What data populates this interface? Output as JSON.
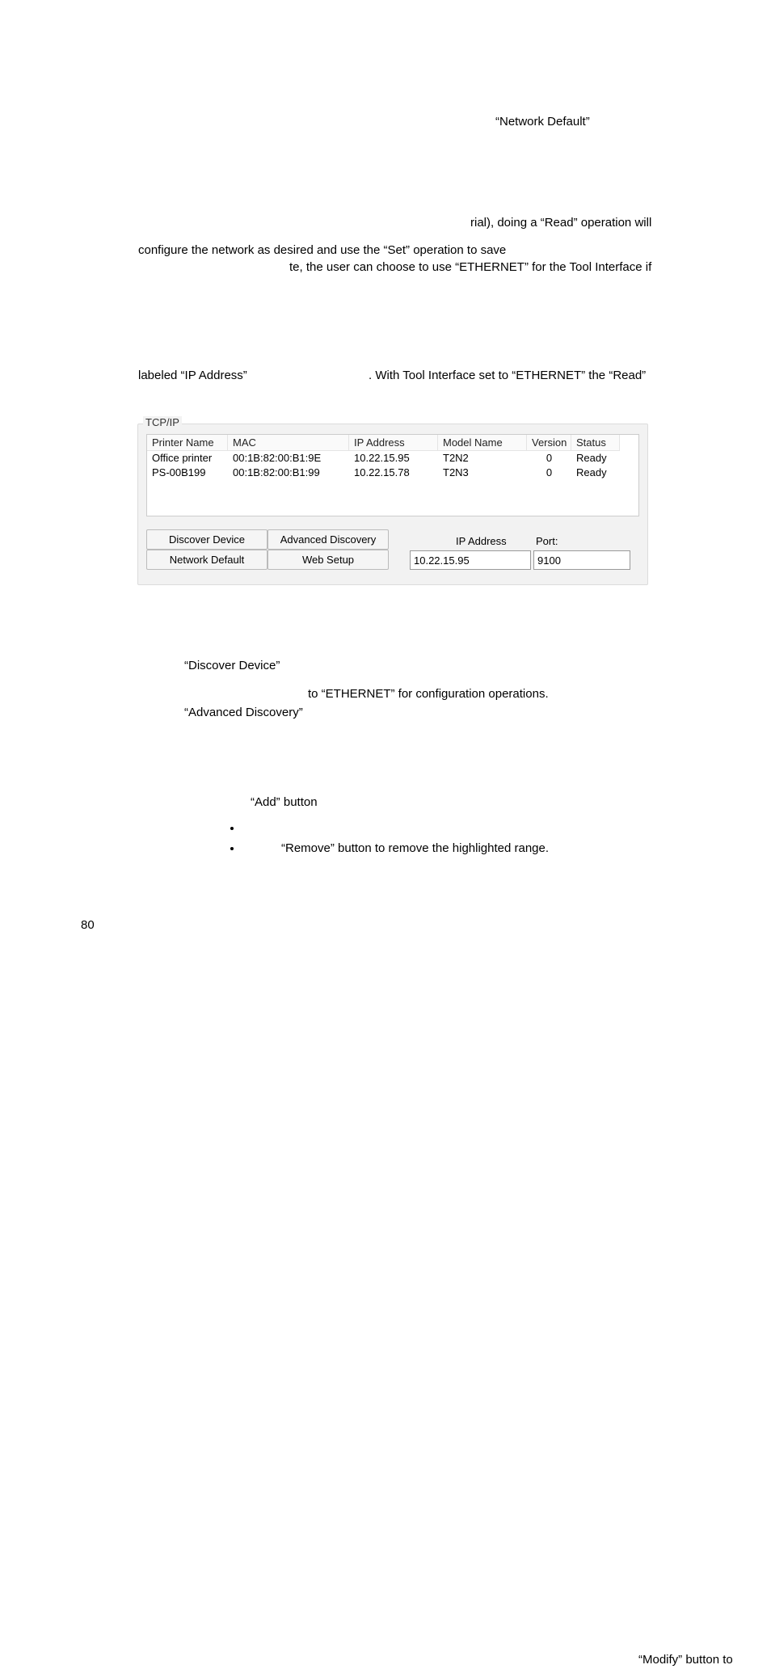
{
  "page_number": "80",
  "frags": {
    "f1": "“Network Default”",
    "f2": "rial), doing a “Read” operation will",
    "f3": "configure the network as desired and use the “Set” operation to save",
    "f4": "te, the user can choose to use “ETHERNET” for the Tool Interface if",
    "f5": "labeled “IP Address”",
    "f6": ". With Tool Interface set to “ETHERNET”  the “Read”",
    "f7": "“Discover Device”",
    "f8": "to “ETHERNET” for configuration operations.",
    "f9": "“Advanced Discovery”",
    "f10": "“Add” button",
    "f11": "“Modify” button to",
    "f12": "“Remove” button to remove the highlighted range."
  },
  "panel": {
    "title": "TCP/IP",
    "columns": [
      "Printer Name",
      "MAC",
      "IP Address",
      "Model Name",
      "Version",
      "Status"
    ],
    "rows": [
      {
        "name": "Office printer",
        "mac": "00:1B:82:00:B1:9E",
        "ip": "10.22.15.95",
        "model": "T2N2",
        "ver": "0",
        "status": "Ready"
      },
      {
        "name": "PS-00B199",
        "mac": "00:1B:82:00:B1:99",
        "ip": "10.22.15.78",
        "model": "T2N3",
        "ver": "0",
        "status": "Ready"
      }
    ],
    "buttons": {
      "discover": "Discover Device",
      "advanced": "Advanced Discovery",
      "nwdefault": "Network Default",
      "websetup": "Web Setup"
    },
    "ip_label": "IP Address",
    "port_label": "Port:",
    "ip_value": "10.22.15.95",
    "port_value": "9100"
  }
}
